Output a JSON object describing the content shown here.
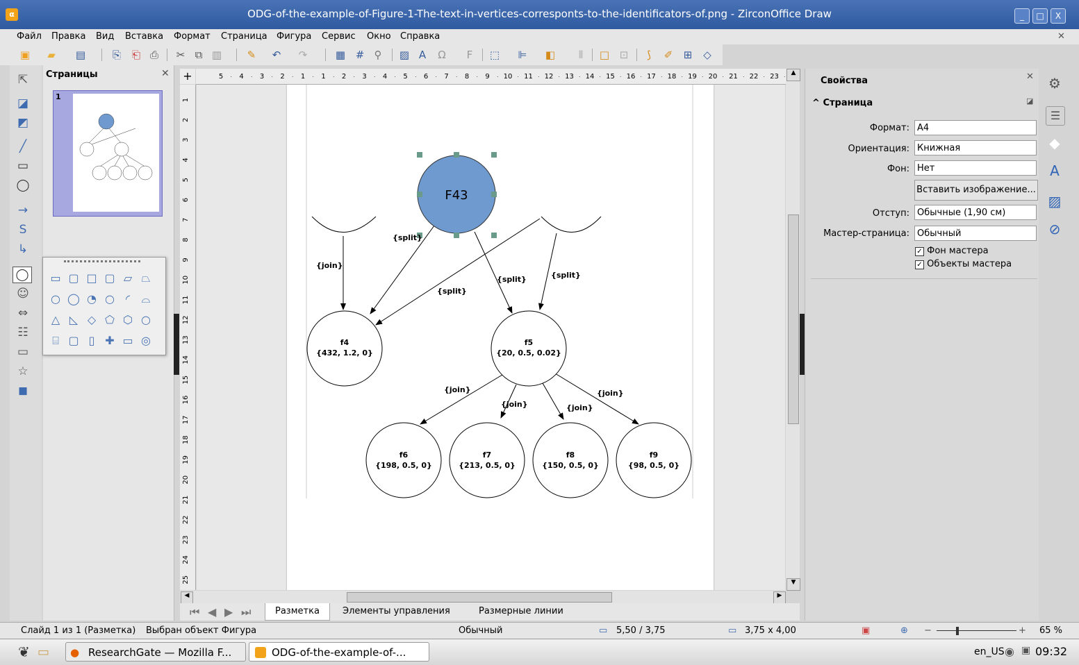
{
  "window": {
    "title": "ODG-of-the-example-of-Figure-1-The-text-in-vertices-corresponts-to-the-identificators-of.png - ZirconOffice Draw",
    "buttons": [
      "_",
      "□",
      "X"
    ]
  },
  "menu": [
    "Файл",
    "Правка",
    "Вид",
    "Вставка",
    "Формат",
    "Страница",
    "Фигура",
    "Сервис",
    "Окно",
    "Справка"
  ],
  "slides_panel": {
    "title": "Страницы",
    "slide_number": "1"
  },
  "rulers": {
    "horizontal": [
      "5",
      "4",
      "3",
      "2",
      "1",
      "1",
      "2",
      "3",
      "4",
      "5",
      "6",
      "7",
      "8",
      "9",
      "10",
      "11",
      "12",
      "13",
      "14",
      "15",
      "16",
      "17",
      "18",
      "19",
      "20",
      "21",
      "22",
      "23"
    ],
    "vertical": [
      "1",
      "2",
      "3",
      "4",
      "5",
      "6",
      "7",
      "8",
      "9",
      "10",
      "11",
      "12",
      "13",
      "14",
      "15",
      "16",
      "17",
      "18",
      "19",
      "20",
      "21",
      "22",
      "23",
      "24",
      "25"
    ]
  },
  "diagram": {
    "root_label": "F43",
    "nodes": [
      {
        "name": "f4",
        "params": "{432, 1.2, 0}"
      },
      {
        "name": "f5",
        "params": "{20, 0.5, 0.02}"
      },
      {
        "name": "f6",
        "params": "{198, 0.5, 0}"
      },
      {
        "name": "f7",
        "params": "{213, 0.5, 0}"
      },
      {
        "name": "f8",
        "params": "{150, 0.5, 0}"
      },
      {
        "name": "f9",
        "params": "{98, 0.5, 0}"
      }
    ],
    "edge_labels": {
      "join_left": "{join}",
      "split_root": "{split}",
      "split_mid": "{split}",
      "split_f5a": "{split}",
      "split_f5b": "{split}",
      "join_f6": "{join}",
      "join_f7": "{join}",
      "join_f8": "{join}",
      "join_f9": "{join}"
    },
    "root_color": "#6f9ad0"
  },
  "tabs": [
    "Разметка",
    "Элементы управления",
    "Размерные линии"
  ],
  "properties": {
    "title": "Свойства",
    "section": "Страница",
    "rows": [
      {
        "label": "Формат:",
        "value": "A4"
      },
      {
        "label": "Ориентация:",
        "value": "Книжная"
      },
      {
        "label": "Фон:",
        "value": "Нет"
      },
      {
        "label": "Отступ:",
        "value": "Обычные (1,90 см)"
      },
      {
        "label": "Мастер-страница:",
        "value": "Обычный"
      }
    ],
    "insert_image_button": "Вставить изображение...",
    "checkbox_master_bg": "Фон мастера",
    "checkbox_master_objects": "Объекты мастера"
  },
  "status": {
    "slide": "Слайд 1 из 1 (Разметка)",
    "selection": "Выбран объект Фигура",
    "style": "Обычный",
    "position": "5,50 / 3,75",
    "size": "3,75 x 4,00",
    "zoom": "65 %"
  },
  "taskbar": {
    "task1": "ResearchGate — Mozilla F...",
    "task2": "ODG-of-the-example-of-...",
    "locale": "en_US",
    "time": "09:32"
  }
}
